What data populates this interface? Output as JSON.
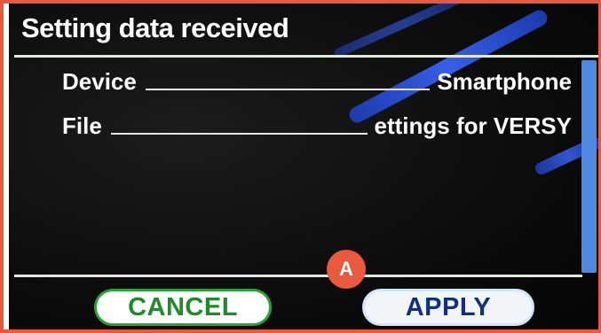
{
  "dialog": {
    "title": "Setting data received",
    "rows": [
      {
        "label": "Device",
        "value": "Smartphone"
      },
      {
        "label": "File",
        "value": "ettings for VERSY"
      }
    ],
    "buttons": {
      "cancel": "CANCEL",
      "apply": "APPLY"
    }
  },
  "annotation": {
    "marker": "A"
  },
  "colors": {
    "frame_border": "#e8593e",
    "screen_background": "#0c0c0c",
    "cancel_text": "#1f8a2a",
    "apply_text": "#13307a",
    "scrollbar": "#4e88e0",
    "marker_background": "#e8593e"
  }
}
